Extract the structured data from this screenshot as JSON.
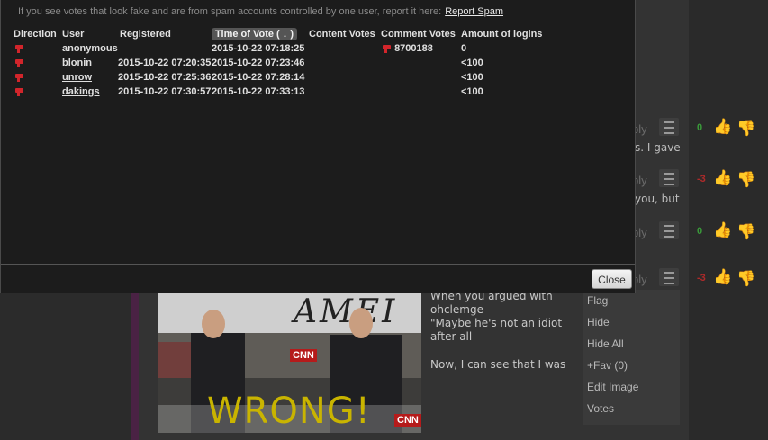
{
  "modal": {
    "notice_text": "If you see votes that look fake and are from spam accounts controlled by one user, report it here:",
    "report_link": "Report Spam",
    "columns": [
      "Direction",
      "User",
      "Registered",
      "Time of Vote ( ↓ )",
      "Content Votes",
      "Comment Votes",
      "Amount of logins"
    ],
    "rows": [
      {
        "direction": "thumbs-down",
        "user": "anonymous",
        "registered": "",
        "time": "2015-10-22 07:18:25",
        "content_votes": "",
        "comment_votes": "8700188",
        "logins": "0"
      },
      {
        "direction": "thumbs-down",
        "user": "blonin",
        "registered": "2015-10-22 07:20:35",
        "time": "2015-10-22 07:23:46",
        "content_votes": "",
        "comment_votes": "",
        "logins": "<100"
      },
      {
        "direction": "thumbs-down",
        "user": "unrow",
        "registered": "2015-10-22 07:25:36",
        "time": "2015-10-22 07:28:14",
        "content_votes": "",
        "comment_votes": "",
        "logins": "<100"
      },
      {
        "direction": "thumbs-down",
        "user": "dakings",
        "registered": "2015-10-22 07:30:57",
        "time": "2015-10-22 07:33:13",
        "content_votes": "",
        "comment_votes": "",
        "logins": "<100"
      }
    ],
    "close_label": "Close"
  },
  "background": {
    "reply_label": "ply",
    "comments": [
      {
        "count": "0",
        "count_color": "#3a9a3a",
        "up_color": "#58a43a",
        "down_color": "#8c2a2a",
        "snippet": "s. I gave"
      },
      {
        "count": "-3",
        "count_color": "#b02a2a",
        "up_color": "#4c4c4c",
        "down_color": "#8c2a2a",
        "snippet": "you, but"
      },
      {
        "count": "0",
        "count_color": "#3a9a3a",
        "up_color": "#58a43a",
        "down_color": "#8c2a2a",
        "snippet": ""
      },
      {
        "count": "-3",
        "count_color": "#b02a2a",
        "up_color": "#4c4c4c",
        "down_color": "#8c2a2a",
        "snippet": ""
      }
    ],
    "comment_line1": "When you argued with ohclemge",
    "comment_line2": "\"Maybe he's not an idiot after all",
    "comment_line3": "Now, I can see that I was",
    "gif_caption": "WRONG!",
    "gif_banner": "AMEI",
    "gif_network": "CNN",
    "context_menu": [
      "Flag",
      "Hide",
      "Hide All",
      "+Fav (0)",
      "Edit Image",
      "Votes"
    ]
  }
}
